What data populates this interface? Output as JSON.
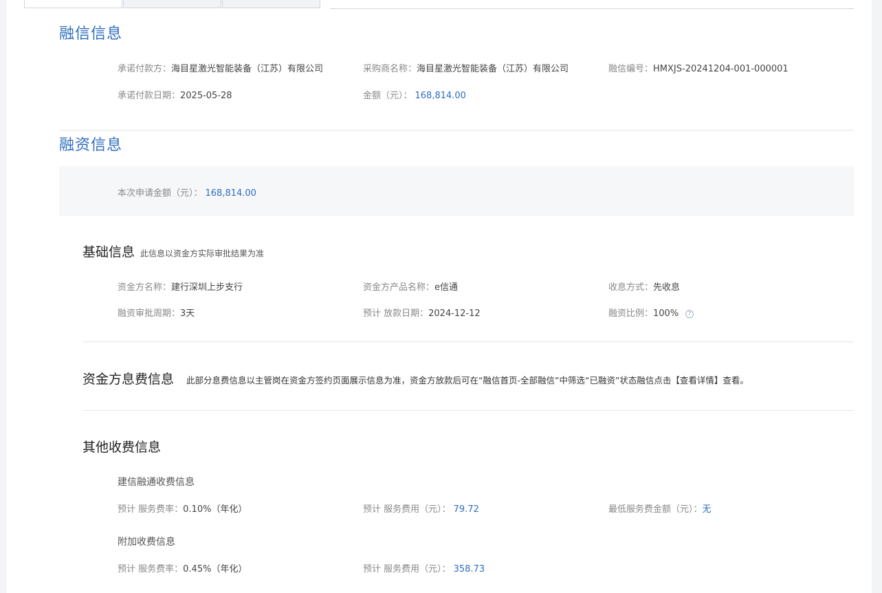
{
  "tabs": [
    "",
    "",
    ""
  ],
  "credit": {
    "title": "融信信息",
    "payer_label": "承诺付款方：",
    "payer_value": "海目星激光智能装备（江苏）有限公司",
    "buyer_label": "采购商名称：",
    "buyer_value": "海目星激光智能装备（江苏）有限公司",
    "code_label": "融信编号：",
    "code_value": "HMXJS-20241204-001-000001",
    "date_label": "承诺付款日期：",
    "date_value": "2025-05-28",
    "amount_label": "金额（元）：",
    "amount_value": "168,814.00"
  },
  "financing": {
    "title": "融资信息",
    "apply_label": "本次申请金额（元）：",
    "apply_value": "168,814.00"
  },
  "basic": {
    "title": "基础信息",
    "note": "此信息以资金方实际审批结果为准",
    "funder_label": "资金方名称：",
    "funder_value": "建行深圳上步支行",
    "product_label": "资金方产品名称：",
    "product_value": "e信通",
    "interest_label": "收息方式：",
    "interest_value": "先收息",
    "period_label": "融资审批周期：",
    "period_value": "3天",
    "loan_date_label": "预计 放款日期：",
    "loan_date_value": "2024-12-12",
    "ratio_label": "融资比例：",
    "ratio_value": "100%",
    "help_icon": "?"
  },
  "fees": {
    "title": "资金方息费信息",
    "note": "此部分息费信息以主管岗在资金方签约页面展示信息为准，资金方放款后可在“融信首页-全部融信”中筛选“已融资”状态融信点击【查看详情】查看。"
  },
  "other": {
    "title": "其他收费信息",
    "group1_title": "建信融通收费信息",
    "g1_rate_label": "预计 服务费率：",
    "g1_rate_value": "0.10%（年化）",
    "g1_fee_label": "预计 服务费用（元）：",
    "g1_fee_value": "79.72",
    "g1_min_label": "最低服务费金额（元）：",
    "g1_min_value": "无",
    "group2_title": "附加收费信息",
    "g2_rate_label": "预计 服务费率：",
    "g2_rate_value": "0.45%（年化）",
    "g2_fee_label": "预计 服务费用（元）：",
    "g2_fee_value": "358.73"
  },
  "colors": {
    "accent": "#2e6dc0",
    "page_bg": "#f3f4f6"
  }
}
